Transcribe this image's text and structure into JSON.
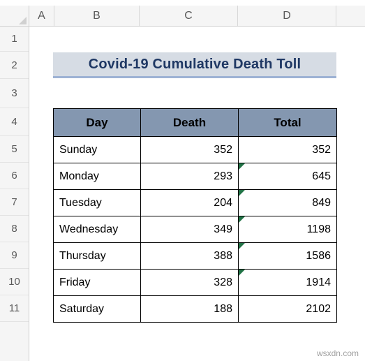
{
  "app": {
    "type": "spreadsheet",
    "watermark": "wsxdn.com"
  },
  "grid": {
    "column_headers": [
      "A",
      "B",
      "C",
      "D"
    ],
    "row_headers": [
      "1",
      "2",
      "3",
      "4",
      "5",
      "6",
      "7",
      "8",
      "9",
      "10",
      "11"
    ]
  },
  "title": {
    "text": "Covid-19 Cumulative Death Toll",
    "background_color": "#D6DCE4",
    "text_color": "#1F3864",
    "underline_color": "#9DB2D4"
  },
  "table": {
    "header_background_color": "#8497B0",
    "border_color": "#000000",
    "columns": [
      "Day",
      "Death",
      "Total"
    ],
    "rows": [
      {
        "day": "Sunday",
        "death": "352",
        "total": "352",
        "has_error_flag": false
      },
      {
        "day": "Monday",
        "death": "293",
        "total": "645",
        "has_error_flag": true
      },
      {
        "day": "Tuesday",
        "death": "204",
        "total": "849",
        "has_error_flag": true
      },
      {
        "day": "Wednesday",
        "death": "349",
        "total": "1198",
        "has_error_flag": true
      },
      {
        "day": "Thursday",
        "death": "388",
        "total": "1586",
        "has_error_flag": true
      },
      {
        "day": "Friday",
        "death": "328",
        "total": "1914",
        "has_error_flag": true
      },
      {
        "day": "Saturday",
        "death": "188",
        "total": "2102",
        "has_error_flag": false
      }
    ]
  }
}
